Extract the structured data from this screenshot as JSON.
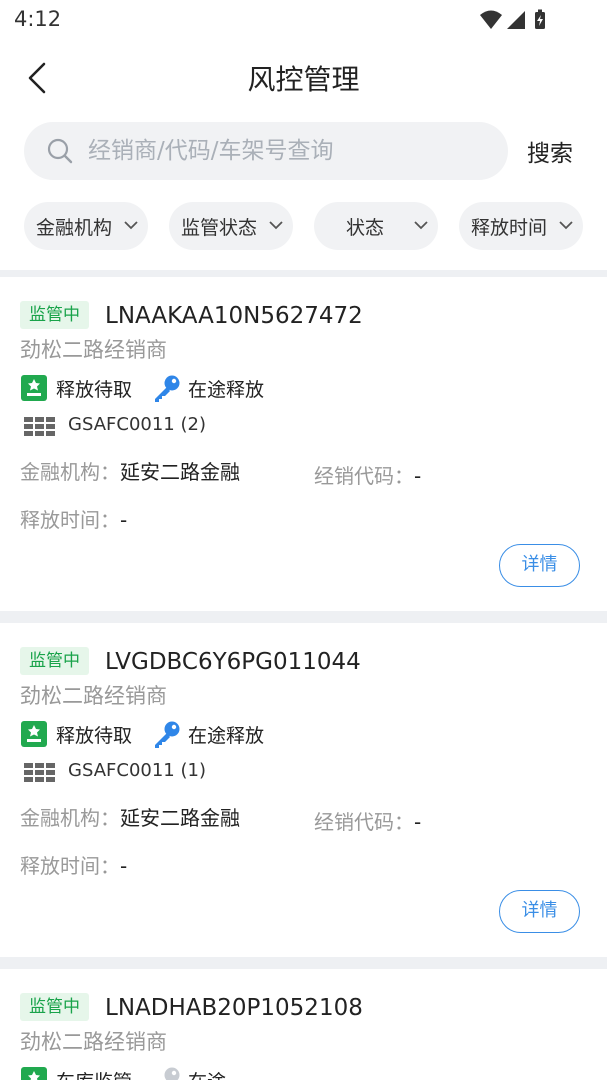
{
  "status_bar": {
    "time": "4:12"
  },
  "header": {
    "title": "风控管理"
  },
  "search": {
    "placeholder": "经销商/代码/车架号查询",
    "button_label": "搜索"
  },
  "filters": [
    {
      "label": "金融机构"
    },
    {
      "label": "监管状态"
    },
    {
      "label": "状态"
    },
    {
      "label": "释放时间"
    }
  ],
  "labels": {
    "finance_org": "金融机构：",
    "dealer_code": "经销代码：",
    "release_time": "释放时间：",
    "detail": "详情"
  },
  "cards": [
    {
      "status": "监管中",
      "vin": "LNAAKAA10N5627472",
      "dealer": "劲松二路经销商",
      "tag1": "释放待取",
      "tag2": "在途释放",
      "code": "GSAFC0011 (2)",
      "finance_org": "延安二路金融",
      "dealer_code": "-",
      "release_time": "-"
    },
    {
      "status": "监管中",
      "vin": "LVGDBC6Y6PG011044",
      "dealer": "劲松二路经销商",
      "tag1": "释放待取",
      "tag2": "在途释放",
      "code": "GSAFC0011 (1)",
      "finance_org": "延安二路金融",
      "dealer_code": "-",
      "release_time": "-"
    },
    {
      "status": "监管中",
      "vin": "LNADHAB20P1052108",
      "dealer": "劲松二路经销商",
      "tag1": "车库监管",
      "tag2": "在途"
    }
  ],
  "colors": {
    "accent_blue": "#3a8ee6",
    "status_green": "#19a34a",
    "status_green_bg": "#e6f6ea",
    "chip_bg": "#f1f2f4"
  },
  "icons": {
    "back": "chevron-left-icon",
    "search": "search-icon",
    "chip_arrow": "chevron-down-icon",
    "release_pending": "stamp-icon",
    "transit_release": "key-icon",
    "code": "grid-icon"
  }
}
